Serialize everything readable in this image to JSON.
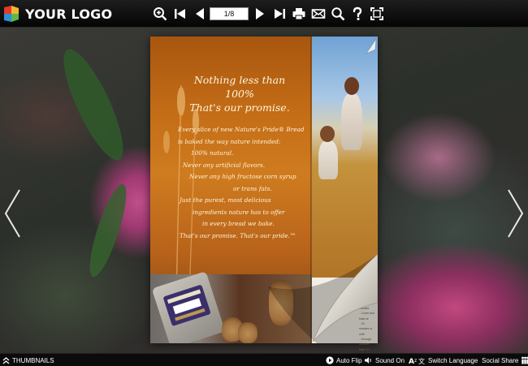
{
  "header": {
    "logo_text": "YOUR LOGO",
    "page_indicator": "1/8",
    "tools": [
      "zoom-in-icon",
      "first-page-icon",
      "previous-page-icon",
      "next-page-icon",
      "last-page-icon",
      "print-icon",
      "email-icon",
      "search-icon",
      "help-icon",
      "fullscreen-icon"
    ]
  },
  "page_left": {
    "tagline": [
      "Nothing less than 100%",
      "That's our promise."
    ],
    "body": [
      "Every slice of new Nature's Pride® Bread",
      "is baked the way nature intended:",
      "100% natural.",
      "Never any artificial flavors.",
      "Never any high fructose corn syrup",
      "or trans fats.",
      "Just the purest, most delicious",
      "ingredients nature has to offer",
      "in every bread we bake.",
      "That's our promise. That's our pride.™"
    ]
  },
  "page_right": {
    "small_text": [
      "...pride. There's the",
      "...s. Reserve",
      "...tagged 10 minutes",
      "...Cover and bake at",
      "...20 minutes or until",
      "...through. Uncover, bake 10",
      "...re. Let stand 5 minutes before cutting."
    ]
  },
  "footer": {
    "thumbnails_label": "THUMBNAILS",
    "auto_flip_label": "Auto Flip",
    "sound_label": "Sound On",
    "language_label": "Switch Language",
    "share_label": "Social Share"
  },
  "colors": {
    "toolbar_bg": "#0b0b0b",
    "page_orange": "#c46d17",
    "accent_white": "#ffffff"
  }
}
